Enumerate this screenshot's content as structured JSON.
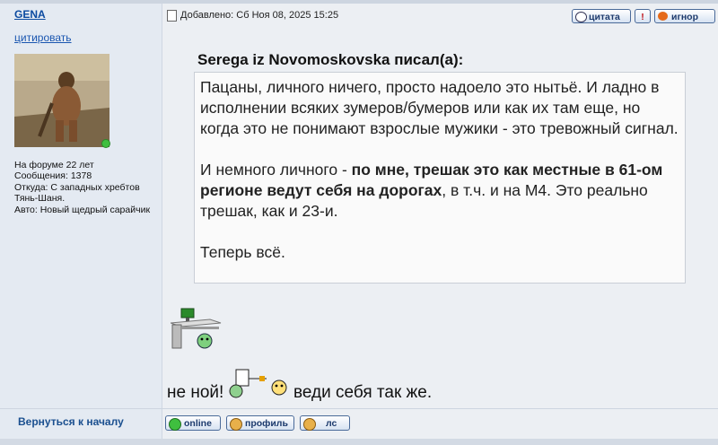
{
  "author": {
    "username": "GENA",
    "quote_link": "цитировать",
    "info": [
      "На форуме 22 лет",
      "Сообщения: 1378",
      "Откуда: С западных хребтов",
      "Тянь-Шаня.",
      "Авто: Новый щедрый сарайчик"
    ],
    "status": "online"
  },
  "post": {
    "added": "Добавлено: Сб Ноя 08, 2025 15:25",
    "buttons": {
      "quote": "цитата",
      "report": "!",
      "ignore": "игнор"
    },
    "quote_author": "Serega iz Novomoskovska писал(а):",
    "quote_p1": "Пацаны, личного ничего, просто надоело это нытьё. И ладно в исполнении всяких зумеров/бумеров или как их там еще, но когда это не понимают взрослые мужики - это тревожный сигнал.",
    "quote_p2_start": "И немного личного - ",
    "quote_p2_bold": "по мне, трешак это как местные в 61-ом регионе ведут себя на дорогах",
    "quote_p2_end": ", в т.ч. и на М4. Это реально трешак, как и 23-и.",
    "quote_p3": "Теперь всё.",
    "after_text_1": "не ной!",
    "after_text_2": "веди себя так же."
  },
  "footer": {
    "back": "Вернуться к началу",
    "buttons": {
      "online": "online",
      "profile": "профиль",
      "pm": "лс"
    }
  },
  "colors": {
    "link": "#0b4aa0",
    "sidebar": "#e4eaf2",
    "online": "#3fbf3f"
  }
}
